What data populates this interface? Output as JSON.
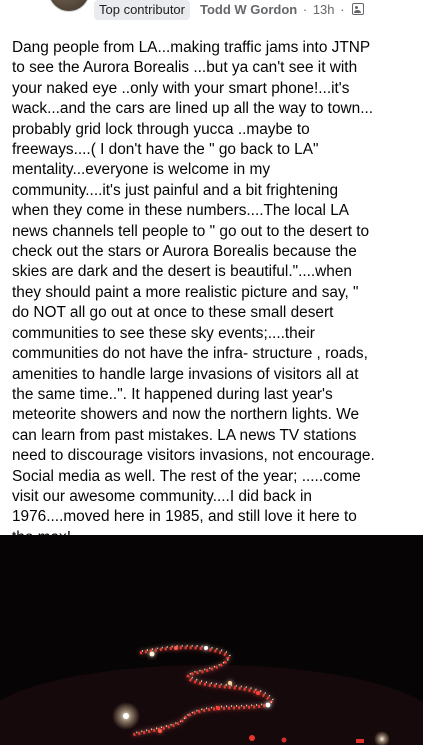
{
  "post": {
    "badge_label": "Top contributor",
    "author_name": "Todd W Gordon",
    "separator": "·",
    "timestamp": "13h",
    "separator2": "·",
    "privacy_icon": "audience-icon",
    "body": "Dang people from LA...making traffic jams into JTNP\nto see the Aurora Borealis ...but ya can't see it with\nyour naked eye ..only with your smart phone!...it's\nwack...and the cars are lined up all the way to town...\nprobably grid lock through yucca ..maybe to\nfreeways....( I don't have the \" go back to LA\"\nmentality...everyone is welcome in my\ncommunity....it's just painful and a bit frightening\nwhen they come in these numbers....The local LA\nnews channels tell people to \" go out to the desert to\ncheck out the stars or Aurora Borealis because the\nskies are dark and the desert is beautiful.\"....when\nthey should paint a more realistic picture and say, \"\ndo NOT all go out at once to these small desert\ncommunities to see these sky events;....their\ncommunities do not have the infra- structure , roads,\namenities to handle large invasions of visitors all at\nthe same time..\". It happened during last year's\nmeteorite showers and now the northern lights.  We\ncan learn from past mistakes.  LA news TV stations\nneed to discourage visitors invasions, not encourage.\nSocial media as well.   The rest of the year;  .....come\nvisit our awesome community....I did back in\n1976....moved here in 1985, and still love it here to\nthe max!"
  },
  "image": {
    "subject": "night photo of a long line of car headlights and taillights winding through the dark desert"
  },
  "colors": {
    "badge_bg": "#e9ebee",
    "meta_text": "#65676b",
    "body_text": "#050505",
    "image_bg": "#050304",
    "headlight": "#fff4d6",
    "taillight": "#ff3b30"
  }
}
